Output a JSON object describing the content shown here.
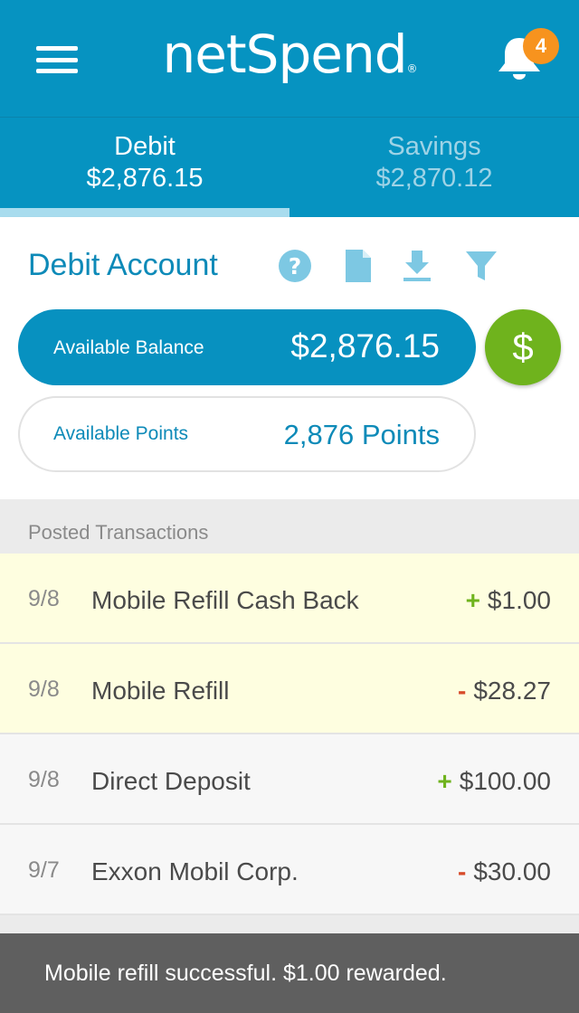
{
  "header": {
    "logo_text": "netSpend",
    "logo_mark": "®",
    "notification_count": "4",
    "menu_icon": "hamburger-menu-icon",
    "bell_icon": "bell-icon",
    "brand_color": "#0693c1"
  },
  "tabs": [
    {
      "label": "Debit",
      "amount": "$2,876.15",
      "active": true
    },
    {
      "label": "Savings",
      "amount": "$2,870.12",
      "active": false
    }
  ],
  "account": {
    "title": "Debit Account",
    "tools": [
      "help-icon",
      "document-icon",
      "download-icon",
      "filter-icon"
    ],
    "balance_label": "Available Balance",
    "balance_value": "$2,876.15",
    "dollar_symbol": "$",
    "points_label": "Available Points",
    "points_value": "2,876 Points"
  },
  "transactions": {
    "heading": "Posted Transactions",
    "items": [
      {
        "date": "9/8",
        "description": "Mobile Refill Cash Back",
        "sign": "+",
        "amount": "$1.00"
      },
      {
        "date": "9/8",
        "description": "Mobile Refill",
        "sign": "-",
        "amount": "$28.27"
      },
      {
        "date": "9/8",
        "description": "Direct Deposit",
        "sign": "+",
        "amount": "$100.00"
      },
      {
        "date": "9/7",
        "description": "Exxon Mobil Corp.",
        "sign": "-",
        "amount": "$30.00"
      }
    ]
  },
  "toast": {
    "message": "Mobile refill successful. $1.00 rewarded."
  }
}
